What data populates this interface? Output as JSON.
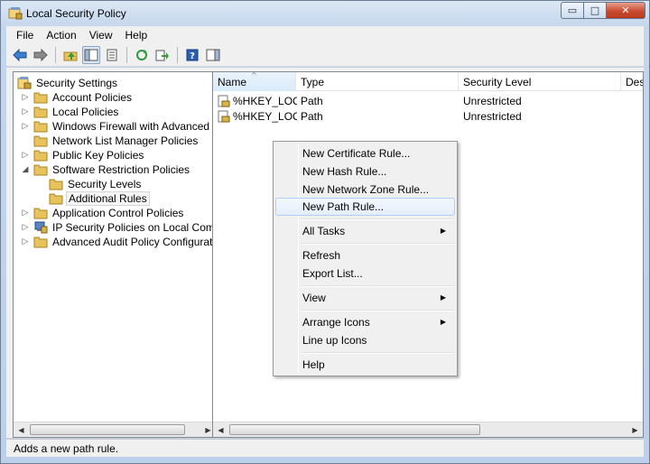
{
  "window": {
    "title": "Local Security Policy",
    "caption_buttons": {
      "minimize": "▭",
      "maximize": "□",
      "close": "✕"
    }
  },
  "menubar": {
    "items": [
      "File",
      "Action",
      "View",
      "Help"
    ]
  },
  "toolbar": {
    "buttons": [
      "back-arrow-icon",
      "forward-arrow-icon",
      "up-folder-icon",
      "show-hide-tree-icon",
      "properties-icon",
      "refresh-icon",
      "export-list-icon",
      "help-icon",
      "show-hide-action-pane-icon"
    ]
  },
  "tree": {
    "root": "Security Settings",
    "items": [
      {
        "label": "Account Policies",
        "expander": "▷",
        "icon": "folder-icon"
      },
      {
        "label": "Local Policies",
        "expander": "▷",
        "icon": "folder-icon"
      },
      {
        "label": "Windows Firewall with Advanced Secu",
        "expander": "▷",
        "icon": "folder-icon"
      },
      {
        "label": "Network List Manager Policies",
        "expander": "",
        "icon": "folder-icon"
      },
      {
        "label": "Public Key Policies",
        "expander": "▷",
        "icon": "folder-icon"
      },
      {
        "label": "Software Restriction Policies",
        "expander": "◢",
        "icon": "folder-icon"
      },
      {
        "label": "Security Levels",
        "expander": "",
        "icon": "folder-icon"
      },
      {
        "label": "Additional Rules",
        "expander": "",
        "icon": "folder-icon",
        "selected": true
      },
      {
        "label": "Application Control Policies",
        "expander": "▷",
        "icon": "folder-icon"
      },
      {
        "label": "IP Security Policies on Local Compute",
        "expander": "▷",
        "icon": "ip-security-icon"
      },
      {
        "label": "Advanced Audit Policy Configuration",
        "expander": "▷",
        "icon": "folder-icon"
      }
    ]
  },
  "list": {
    "columns": [
      "Name",
      "Type",
      "Security Level",
      "Des"
    ],
    "sort_indicator": "^",
    "rows": [
      {
        "name": "%HKEY_LOC...",
        "type": "Path",
        "security_level": "Unrestricted"
      },
      {
        "name": "%HKEY_LOC...",
        "type": "Path",
        "security_level": "Unrestricted"
      }
    ]
  },
  "context_menu": {
    "items": [
      {
        "label": "New Certificate Rule..."
      },
      {
        "label": "New Hash Rule..."
      },
      {
        "label": "New Network Zone Rule..."
      },
      {
        "label": "New Path Rule...",
        "highlighted": true
      },
      {
        "label": "All Tasks",
        "submenu": "▶"
      },
      {
        "label": "Refresh"
      },
      {
        "label": "Export List..."
      },
      {
        "label": "View",
        "submenu": "▶"
      },
      {
        "label": "Arrange Icons",
        "submenu": "▶"
      },
      {
        "label": "Line up Icons"
      },
      {
        "label": "Help"
      }
    ]
  },
  "scroll_arrows": {
    "left": "◀",
    "right": "▶"
  },
  "statusbar": {
    "text": "Adds a new path rule."
  },
  "colors": {
    "selection_highlight": "#aecff7",
    "window_frame": "#c4d6ec",
    "folder": "#e8c25a"
  }
}
